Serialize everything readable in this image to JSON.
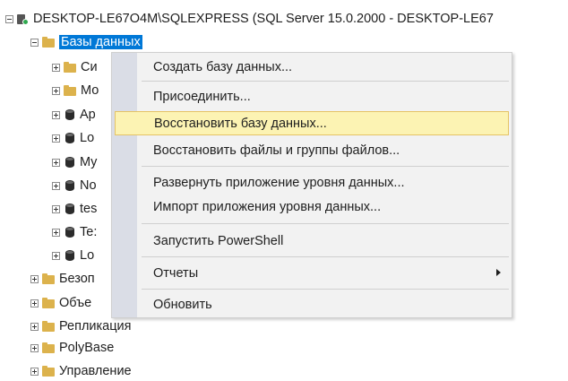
{
  "tree": {
    "server": "DESKTOP-LE67O4M\\SQLEXPRESS (SQL Server 15.0.2000 - DESKTOP-LE67",
    "databases": "Базы данных",
    "db_children": [
      {
        "label": "Си",
        "icon": "folder"
      },
      {
        "label": "Мо",
        "icon": "folder"
      },
      {
        "label": "Ap",
        "icon": "database"
      },
      {
        "label": "Lo",
        "icon": "database"
      },
      {
        "label": "My",
        "icon": "database"
      },
      {
        "label": "No",
        "icon": "database"
      },
      {
        "label": "tes",
        "icon": "database"
      },
      {
        "label": "Te:",
        "icon": "database"
      },
      {
        "label": "Lo",
        "icon": "database"
      }
    ],
    "top_folders": [
      "Безоп",
      "Объе",
      "Репликация",
      "PolyBase",
      "Управление"
    ]
  },
  "context_menu": {
    "items": [
      "Создать базу данных...",
      "Присоединить...",
      "Восстановить базу данных...",
      "Восстановить файлы и группы файлов...",
      "Развернуть приложение уровня данных...",
      "Импорт приложения уровня данных...",
      "Запустить PowerShell",
      "Отчеты",
      "Обновить"
    ]
  },
  "colors": {
    "selection": "#0078d7",
    "menu_highlight": "#fcf3b3",
    "menu_highlight_border": "#e5c365",
    "folder": "#dcb24c"
  }
}
